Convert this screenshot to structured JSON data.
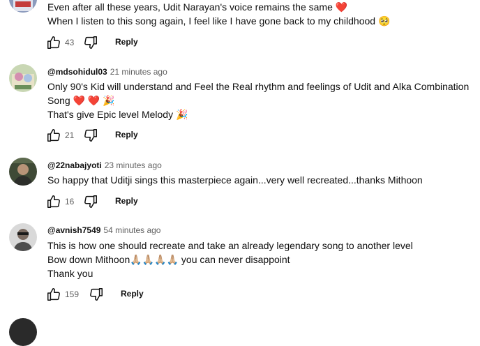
{
  "comments": [
    {
      "author": "",
      "time": "",
      "lines": [
        "Even after all these years, Udit Narayan's voice remains the same ❤️",
        "When I listen to this song again, I feel like I have gone back to my childhood 🥺"
      ],
      "likes": "43",
      "reply_label": "Reply"
    },
    {
      "author": "@mdsohidul03",
      "time": "21 minutes ago",
      "lines": [
        "Only 90's Kid will understand and Feel the Real rhythm and feelings of Udit and Alka Combination",
        "Song ❤️ ❤️ 🎉",
        "That's give Epic level Melody 🎉"
      ],
      "likes": "21",
      "reply_label": "Reply"
    },
    {
      "author": "@22nabajyoti",
      "time": "23 minutes ago",
      "lines": [
        "So happy that Uditji sings this masterpiece again...very well recreated...thanks Mithoon"
      ],
      "likes": "16",
      "reply_label": "Reply"
    },
    {
      "author": "@avnish7549",
      "time": "54 minutes ago",
      "lines": [
        "This is how one should recreate and take an already legendary song to another level",
        "Bow down Mithoon🙏🏼🙏🏼🙏🏼🙏🏼 you can never disappoint",
        "Thank you"
      ],
      "likes": "159",
      "reply_label": "Reply"
    }
  ],
  "icons": {
    "like": "thumbs-up-icon",
    "dislike": "thumbs-down-icon"
  },
  "colors": {
    "text": "#0f0f0f",
    "secondary": "#606060"
  }
}
